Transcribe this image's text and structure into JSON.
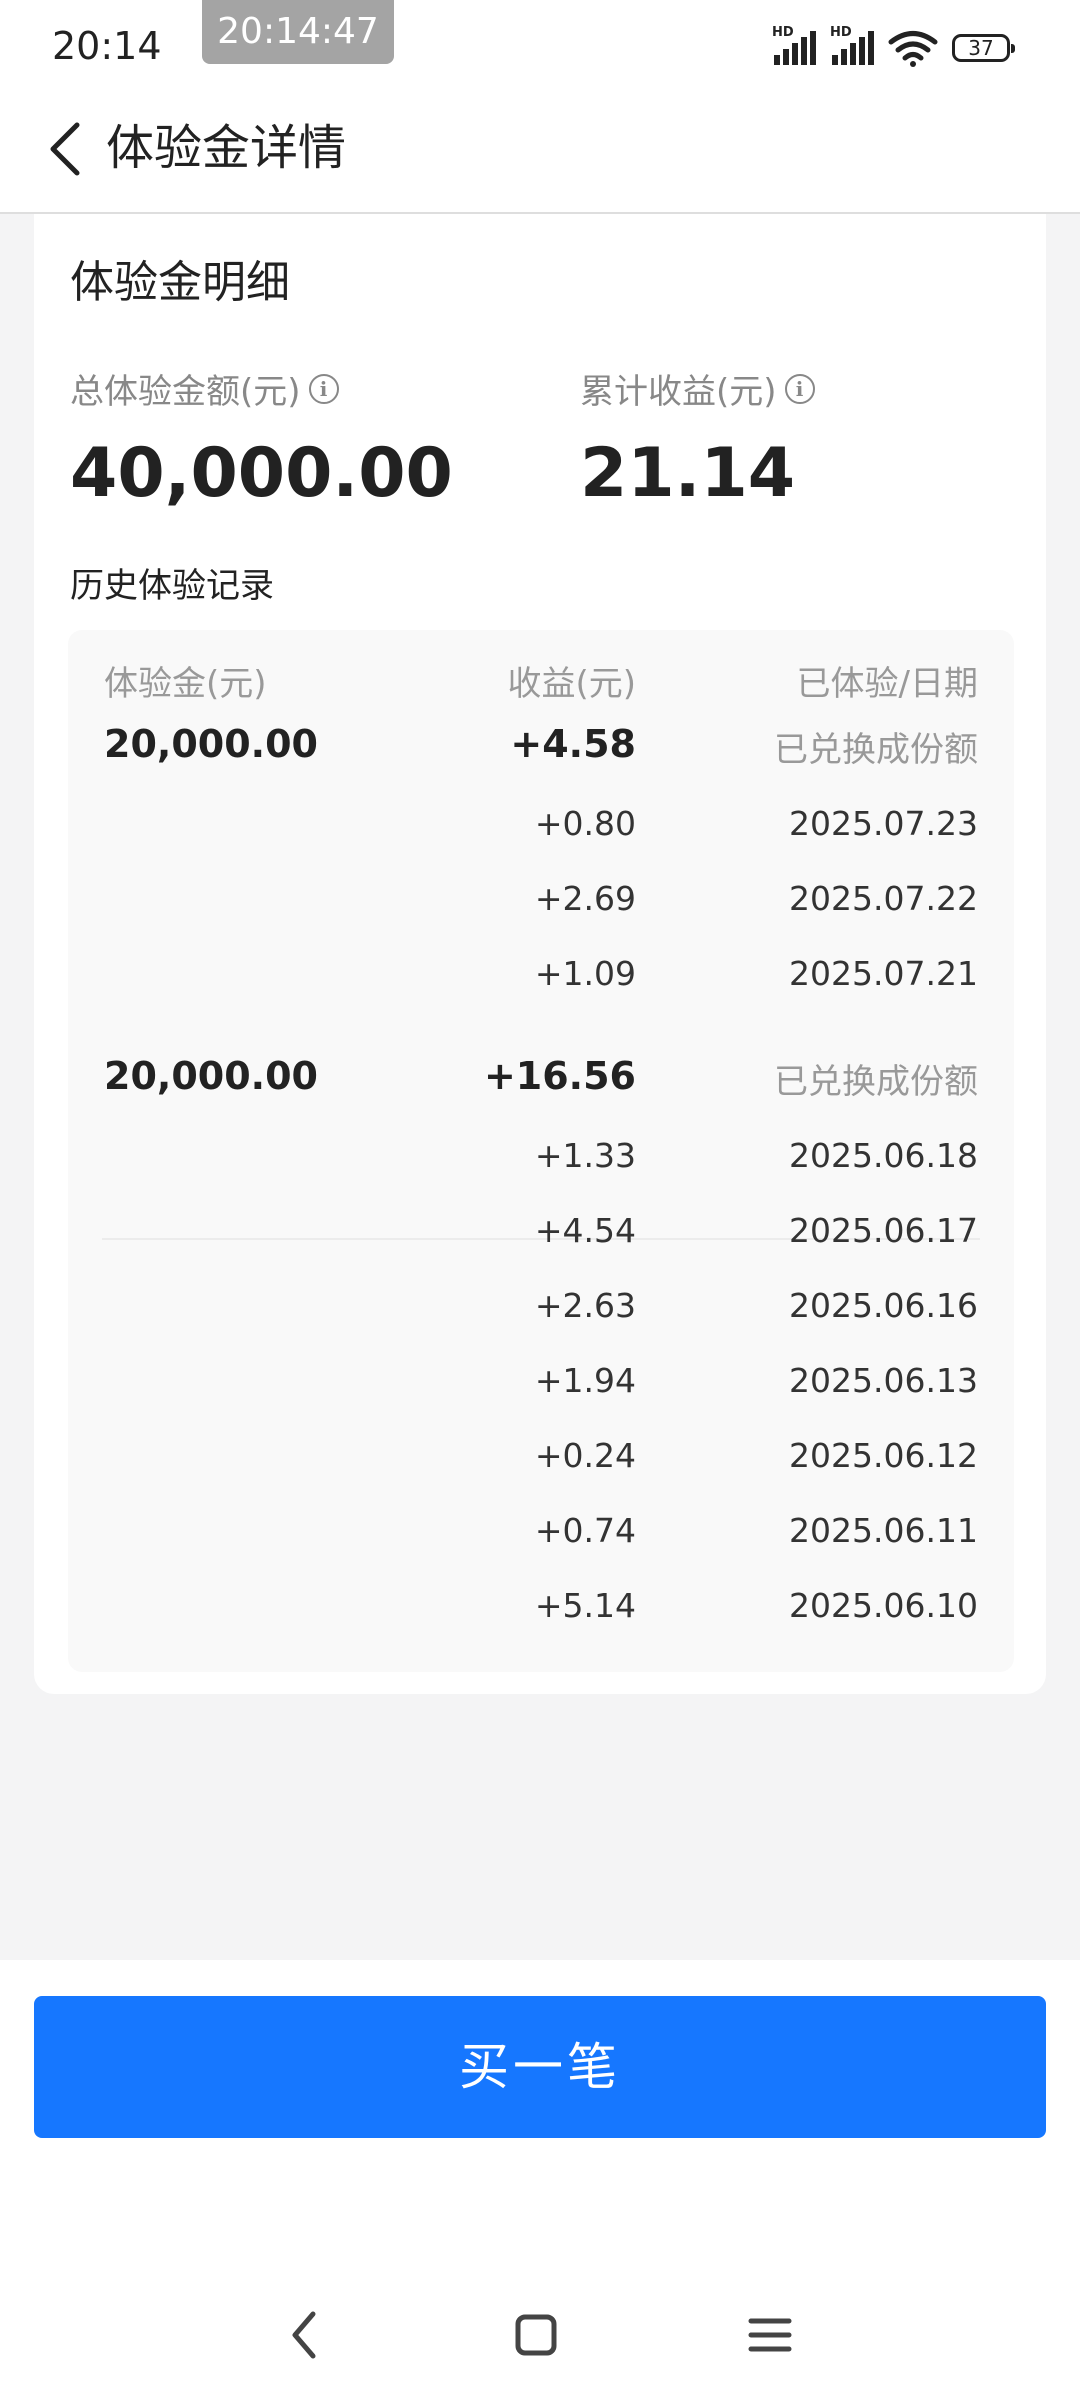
{
  "status_bar": {
    "time": "20:14",
    "clock_overlay": "20:14:47",
    "battery": "37",
    "signal_label": "HD"
  },
  "header": {
    "title": "体验金详情"
  },
  "card": {
    "title": "体验金明细",
    "total_label": "总体验金额(元)",
    "total_value": "40,000.00",
    "income_label": "累计收益(元)",
    "income_value": "21.14",
    "history_title": "历史体验记录",
    "columns": [
      "体验金(元)",
      "收益(元)",
      "已体验/日期"
    ],
    "groups": [
      {
        "amount": "20,000.00",
        "total_income": "+4.58",
        "status": "已兑换成份额",
        "rows": [
          {
            "income": "+0.80",
            "date": "2025.07.23"
          },
          {
            "income": "+2.69",
            "date": "2025.07.22"
          },
          {
            "income": "+1.09",
            "date": "2025.07.21"
          }
        ]
      },
      {
        "amount": "20,000.00",
        "total_income": "+16.56",
        "status": "已兑换成份额",
        "rows": [
          {
            "income": "+1.33",
            "date": "2025.06.18"
          },
          {
            "income": "+4.54",
            "date": "2025.06.17"
          },
          {
            "income": "+2.63",
            "date": "2025.06.16"
          },
          {
            "income": "+1.94",
            "date": "2025.06.13"
          },
          {
            "income": "+0.24",
            "date": "2025.06.12"
          },
          {
            "income": "+0.74",
            "date": "2025.06.11"
          },
          {
            "income": "+5.14",
            "date": "2025.06.10"
          }
        ]
      }
    ]
  },
  "buy_button": "买一笔",
  "colors": {
    "primary": "#1677ff",
    "background": "#f4f4f5"
  }
}
